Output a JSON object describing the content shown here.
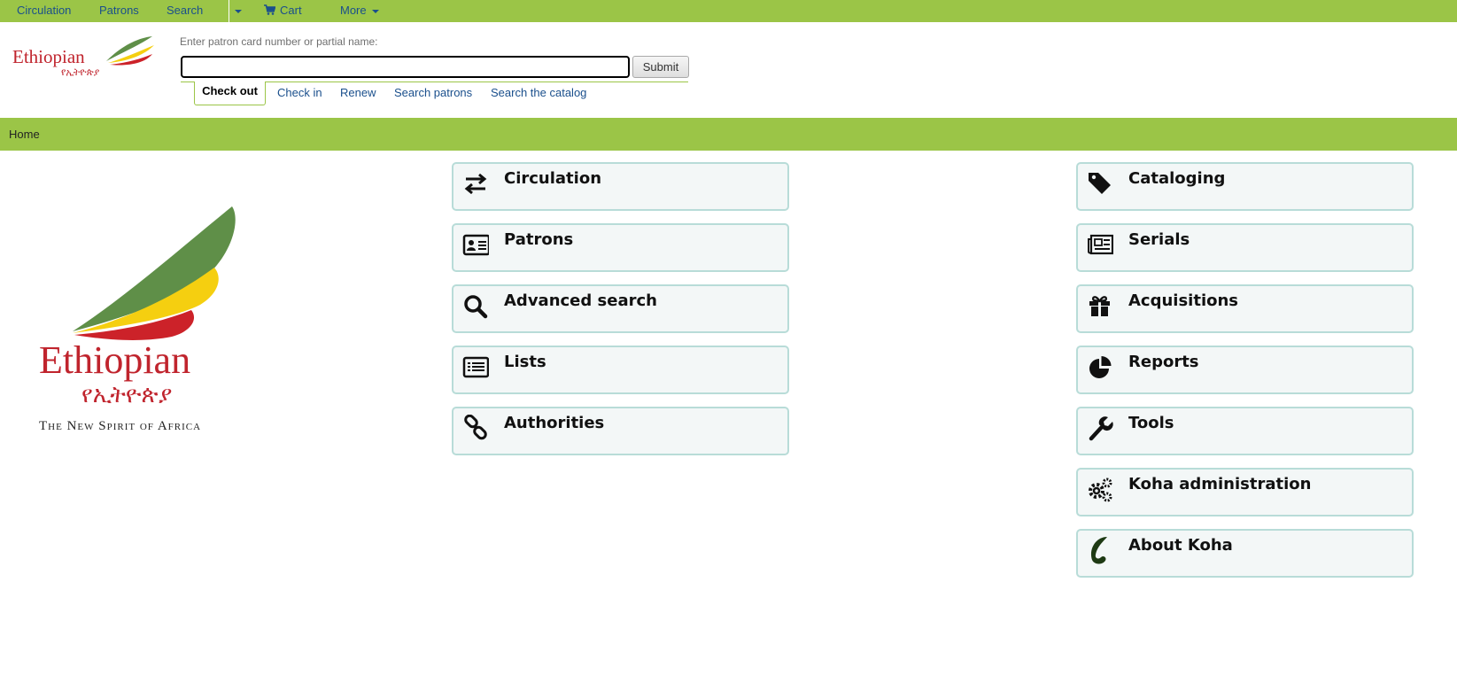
{
  "topnav": {
    "circulation": "Circulation",
    "patrons": "Patrons",
    "search": "Search",
    "cart": "Cart",
    "more": "More"
  },
  "header": {
    "logo_text": "Ethiopian",
    "logo_script": "የኢትዮጵያ",
    "search_label": "Enter patron card number or partial name:",
    "search_value": "",
    "submit_label": "Submit",
    "tabs": [
      {
        "label": "Check out",
        "active": true
      },
      {
        "label": "Check in",
        "active": false
      },
      {
        "label": "Renew",
        "active": false
      },
      {
        "label": "Search patrons",
        "active": false
      },
      {
        "label": "Search the catalog",
        "active": false
      }
    ]
  },
  "breadcrumb": {
    "home": "Home"
  },
  "logo": {
    "name": "Ethiopian",
    "script": "የኢትዮጵያ",
    "tagline": "The New Spirit of Africa",
    "colors": {
      "green": "#5f8f48",
      "yellow": "#f5cf10",
      "red": "#cc2229"
    }
  },
  "modules": {
    "left": [
      {
        "label": "Circulation",
        "icon": "exchange-arrows-icon"
      },
      {
        "label": "Patrons",
        "icon": "id-card-icon"
      },
      {
        "label": "Advanced search",
        "icon": "magnifier-icon"
      },
      {
        "label": "Lists",
        "icon": "list-icon"
      },
      {
        "label": "Authorities",
        "icon": "chain-link-icon"
      }
    ],
    "right": [
      {
        "label": "Cataloging",
        "icon": "tag-icon"
      },
      {
        "label": "Serials",
        "icon": "newspaper-icon"
      },
      {
        "label": "Acquisitions",
        "icon": "gift-icon"
      },
      {
        "label": "Reports",
        "icon": "pie-chart-icon"
      },
      {
        "label": "Tools",
        "icon": "wrench-icon"
      },
      {
        "label": "Koha administration",
        "icon": "gears-icon"
      },
      {
        "label": "About Koha",
        "icon": "koha-leaf-icon"
      }
    ]
  },
  "colors": {
    "accent_green": "#9bc547",
    "link_blue": "#1a4f8c",
    "tile_background": "#f3f7f7",
    "tile_border": "#b8dcd8"
  }
}
